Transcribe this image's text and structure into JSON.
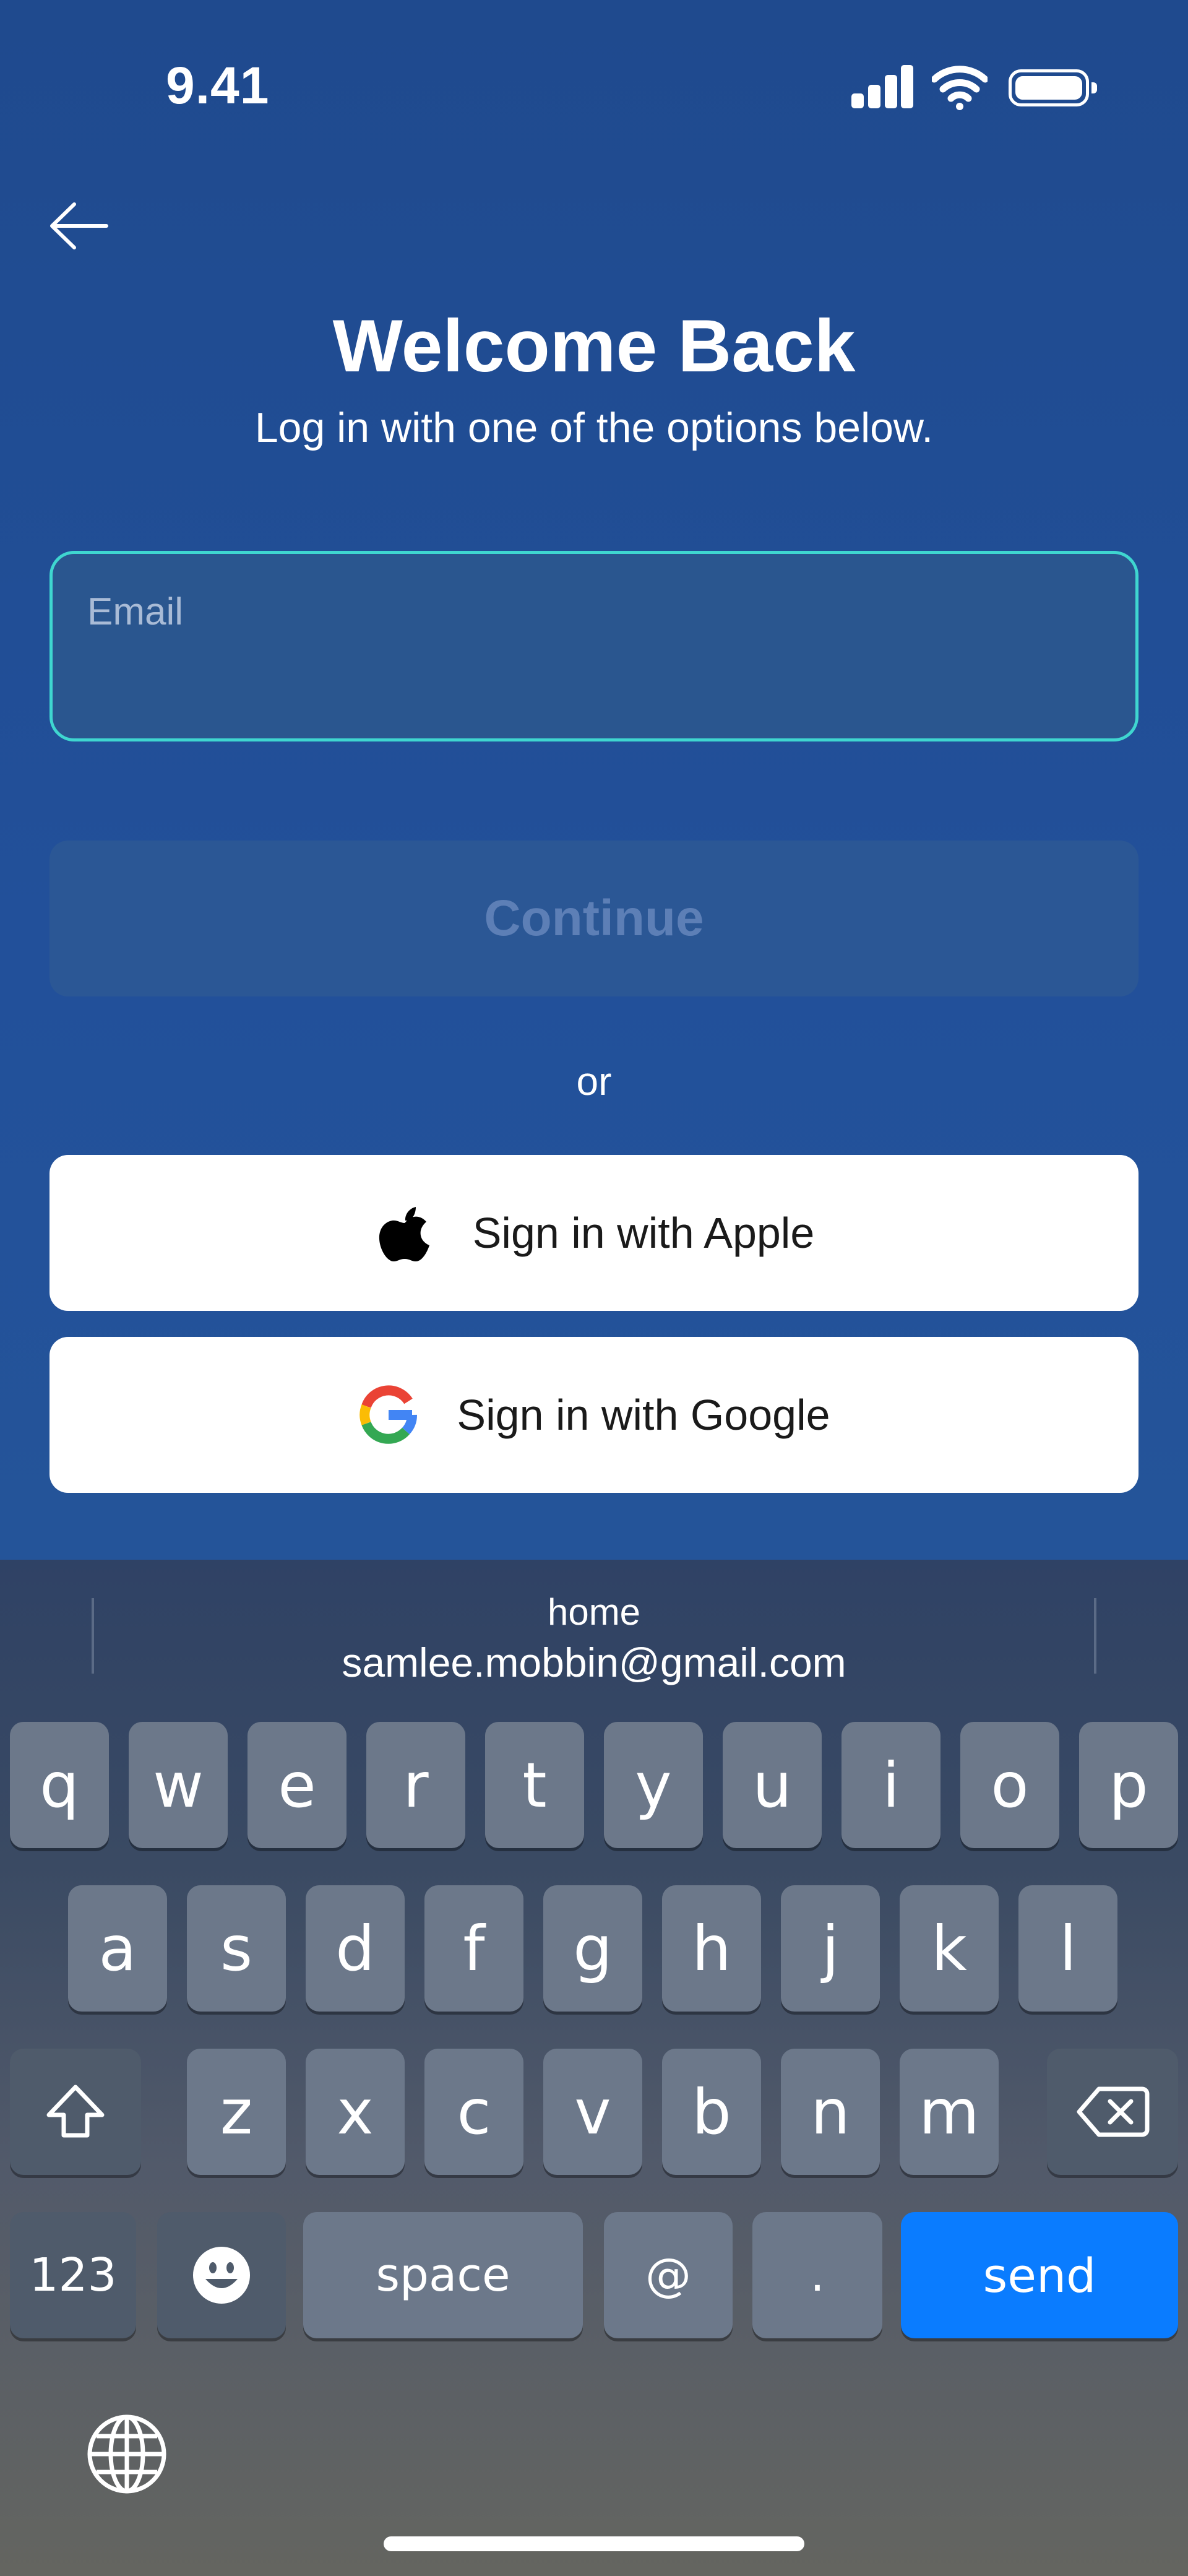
{
  "status_bar": {
    "time": "9.41"
  },
  "header": {
    "title": "Welcome Back",
    "subtitle": "Log in with one of the options below."
  },
  "form": {
    "email_placeholder": "Email",
    "email_value": "",
    "continue_label": "Continue",
    "or_label": "or",
    "apple_label": "Sign in with Apple",
    "google_label": "Sign in with Google"
  },
  "keyboard": {
    "suggestions": [
      "home",
      "samlee.mobbin@gmail.com"
    ],
    "row1": [
      "q",
      "w",
      "e",
      "r",
      "t",
      "y",
      "u",
      "i",
      "o",
      "p"
    ],
    "row2": [
      "a",
      "s",
      "d",
      "f",
      "g",
      "h",
      "j",
      "k",
      "l"
    ],
    "row3": [
      "z",
      "x",
      "c",
      "v",
      "b",
      "n",
      "m"
    ],
    "numbers_label": "123",
    "space_label": "space",
    "at_label": "@",
    "dot_label": ".",
    "send_label": "send"
  },
  "colors": {
    "background": "#1f4a8e",
    "email_border": "#3fd6d0",
    "send_key": "#0a7cff"
  },
  "icons": [
    "back-arrow-icon",
    "cellular-signal-icon",
    "wifi-icon",
    "battery-icon",
    "apple-logo-icon",
    "google-logo-icon",
    "shift-icon",
    "backspace-icon",
    "emoji-icon",
    "globe-icon"
  ]
}
